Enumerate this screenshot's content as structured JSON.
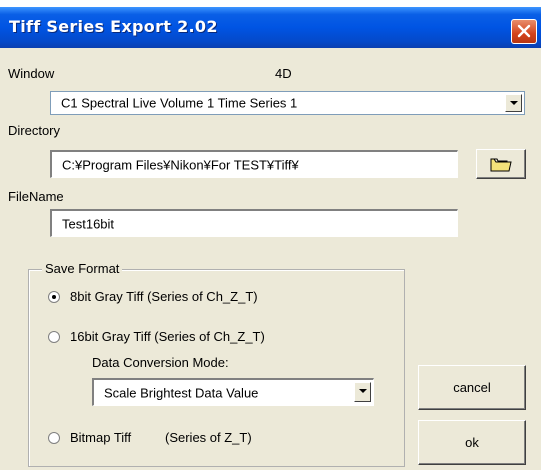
{
  "window": {
    "title": "Tiff Series Export 2.02"
  },
  "labels": {
    "window": "Window",
    "window_mode": "4D",
    "directory": "Directory",
    "filename": "FileName"
  },
  "window_select": {
    "value": "C1 Spectral Live Volume 1 Time Series 1"
  },
  "directory_field": {
    "value": "C:¥Program Files¥Nikon¥For TEST¥Tiff¥"
  },
  "filename_field": {
    "value": "Test16bit"
  },
  "save_format": {
    "legend": "Save Format",
    "options": [
      {
        "label": "8bit Gray Tiff (Series of Ch_Z_T)",
        "checked": true
      },
      {
        "label": "16bit Gray Tiff (Series of Ch_Z_T)",
        "checked": false
      },
      {
        "label": "Bitmap Tiff",
        "suffix": "(Series of Z_T)",
        "checked": false
      }
    ],
    "conversion_label": "Data Conversion Mode:",
    "conversion_value": "Scale Brightest Data Value"
  },
  "buttons": {
    "cancel": "cancel",
    "ok": "ok"
  },
  "icons": {
    "browse": "folder-icon",
    "close": "close-icon"
  },
  "colors": {
    "titlebar": "#0054e3",
    "close": "#d4431c",
    "dialog_bg": "#ece9d8"
  }
}
